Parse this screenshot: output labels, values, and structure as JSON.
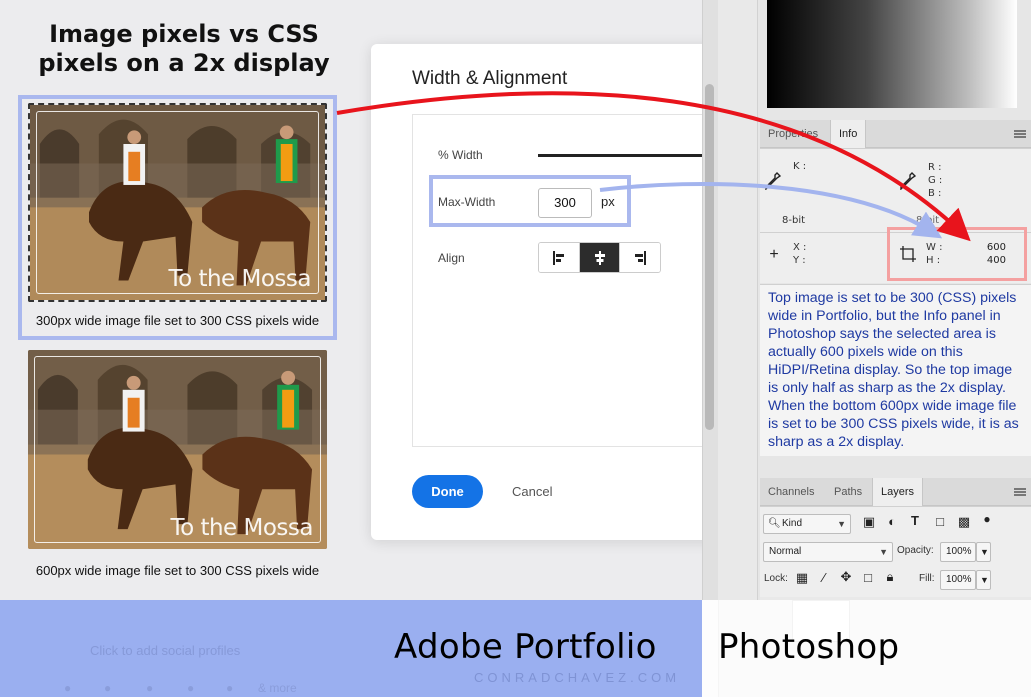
{
  "title": "Image pixels vs CSS pixels on a 2x display",
  "photos": {
    "watermark": "To the Mossa",
    "top_caption": "300px wide image file set to 300 CSS pixels wide",
    "bottom_caption": "600px wide image file set to 300 CSS pixels wide"
  },
  "dialog": {
    "title": "Width & Alignment",
    "width_label": "% Width",
    "maxwidth_label": "Max-Width",
    "maxwidth_value": "300",
    "maxwidth_unit": "px",
    "align_label": "Align",
    "align_options": [
      "align-left",
      "align-center",
      "align-right"
    ],
    "align_selected": "align-center",
    "done_label": "Done",
    "cancel_label": "Cancel"
  },
  "photoshop": {
    "top_tabs": [
      "Properties",
      "Info"
    ],
    "active_top_tab": "Info",
    "info": {
      "k_label": "K :",
      "r_label": "R :",
      "g_label": "G :",
      "b_label": "B :",
      "bit_left": "8-bit",
      "bit_right": "8-bit",
      "x_label": "X :",
      "y_label": "Y :",
      "w_label": "W :",
      "h_label": "H :",
      "w_value": "600",
      "h_value": "400"
    },
    "explanation": "Top image is set to be 300 (CSS) pixels wide in Portfolio, but the Info panel in Photoshop says the selected area is actually 600 pixels wide on this HiDPI/Retina display. So the top image is only half as sharp as the 2x display. When the bottom 600px wide image file is set to be 300 CSS pixels wide, it is as sharp as a 2x display.",
    "bottom_tabs": [
      "Channels",
      "Paths",
      "Layers"
    ],
    "active_bottom_tab": "Layers",
    "kind_filter": "Kind",
    "blend_mode": "Normal",
    "opacity_label": "Opacity:",
    "opacity_value": "100%",
    "lock_label": "Lock:",
    "fill_label": "Fill:",
    "fill_value": "100%"
  },
  "banner": {
    "left_label": "Adobe Portfolio",
    "right_label": "Photoshop",
    "credit": "CONRADCHAVEZ.COM",
    "ghost_social": "Click to add social profiles",
    "social_more": "& more"
  },
  "colors": {
    "highlight_blue": "#aab8ee",
    "highlight_red": "#f4a0a0",
    "arrow_red": "#e8141c",
    "arrow_blue": "#a3b4ee",
    "button_blue": "#1473e6",
    "text_blue": "#1f3aa2",
    "banner_blue": "#9aaff0"
  }
}
